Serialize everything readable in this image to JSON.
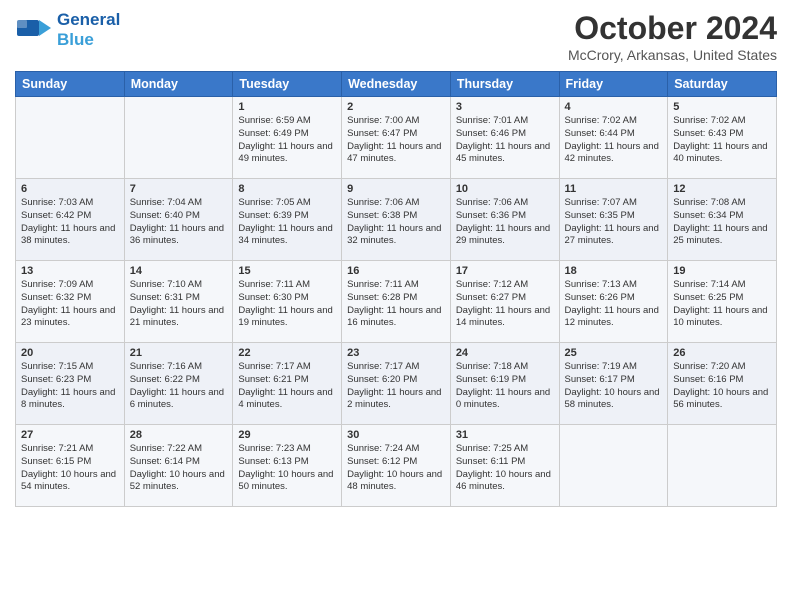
{
  "header": {
    "logo_line1": "General",
    "logo_line2": "Blue",
    "month_title": "October 2024",
    "subtitle": "McCrory, Arkansas, United States"
  },
  "days_of_week": [
    "Sunday",
    "Monday",
    "Tuesday",
    "Wednesday",
    "Thursday",
    "Friday",
    "Saturday"
  ],
  "weeks": [
    [
      {
        "day": "",
        "sunrise": "",
        "sunset": "",
        "daylight": ""
      },
      {
        "day": "",
        "sunrise": "",
        "sunset": "",
        "daylight": ""
      },
      {
        "day": "1",
        "sunrise": "Sunrise: 6:59 AM",
        "sunset": "Sunset: 6:49 PM",
        "daylight": "Daylight: 11 hours and 49 minutes."
      },
      {
        "day": "2",
        "sunrise": "Sunrise: 7:00 AM",
        "sunset": "Sunset: 6:47 PM",
        "daylight": "Daylight: 11 hours and 47 minutes."
      },
      {
        "day": "3",
        "sunrise": "Sunrise: 7:01 AM",
        "sunset": "Sunset: 6:46 PM",
        "daylight": "Daylight: 11 hours and 45 minutes."
      },
      {
        "day": "4",
        "sunrise": "Sunrise: 7:02 AM",
        "sunset": "Sunset: 6:44 PM",
        "daylight": "Daylight: 11 hours and 42 minutes."
      },
      {
        "day": "5",
        "sunrise": "Sunrise: 7:02 AM",
        "sunset": "Sunset: 6:43 PM",
        "daylight": "Daylight: 11 hours and 40 minutes."
      }
    ],
    [
      {
        "day": "6",
        "sunrise": "Sunrise: 7:03 AM",
        "sunset": "Sunset: 6:42 PM",
        "daylight": "Daylight: 11 hours and 38 minutes."
      },
      {
        "day": "7",
        "sunrise": "Sunrise: 7:04 AM",
        "sunset": "Sunset: 6:40 PM",
        "daylight": "Daylight: 11 hours and 36 minutes."
      },
      {
        "day": "8",
        "sunrise": "Sunrise: 7:05 AM",
        "sunset": "Sunset: 6:39 PM",
        "daylight": "Daylight: 11 hours and 34 minutes."
      },
      {
        "day": "9",
        "sunrise": "Sunrise: 7:06 AM",
        "sunset": "Sunset: 6:38 PM",
        "daylight": "Daylight: 11 hours and 32 minutes."
      },
      {
        "day": "10",
        "sunrise": "Sunrise: 7:06 AM",
        "sunset": "Sunset: 6:36 PM",
        "daylight": "Daylight: 11 hours and 29 minutes."
      },
      {
        "day": "11",
        "sunrise": "Sunrise: 7:07 AM",
        "sunset": "Sunset: 6:35 PM",
        "daylight": "Daylight: 11 hours and 27 minutes."
      },
      {
        "day": "12",
        "sunrise": "Sunrise: 7:08 AM",
        "sunset": "Sunset: 6:34 PM",
        "daylight": "Daylight: 11 hours and 25 minutes."
      }
    ],
    [
      {
        "day": "13",
        "sunrise": "Sunrise: 7:09 AM",
        "sunset": "Sunset: 6:32 PM",
        "daylight": "Daylight: 11 hours and 23 minutes."
      },
      {
        "day": "14",
        "sunrise": "Sunrise: 7:10 AM",
        "sunset": "Sunset: 6:31 PM",
        "daylight": "Daylight: 11 hours and 21 minutes."
      },
      {
        "day": "15",
        "sunrise": "Sunrise: 7:11 AM",
        "sunset": "Sunset: 6:30 PM",
        "daylight": "Daylight: 11 hours and 19 minutes."
      },
      {
        "day": "16",
        "sunrise": "Sunrise: 7:11 AM",
        "sunset": "Sunset: 6:28 PM",
        "daylight": "Daylight: 11 hours and 16 minutes."
      },
      {
        "day": "17",
        "sunrise": "Sunrise: 7:12 AM",
        "sunset": "Sunset: 6:27 PM",
        "daylight": "Daylight: 11 hours and 14 minutes."
      },
      {
        "day": "18",
        "sunrise": "Sunrise: 7:13 AM",
        "sunset": "Sunset: 6:26 PM",
        "daylight": "Daylight: 11 hours and 12 minutes."
      },
      {
        "day": "19",
        "sunrise": "Sunrise: 7:14 AM",
        "sunset": "Sunset: 6:25 PM",
        "daylight": "Daylight: 11 hours and 10 minutes."
      }
    ],
    [
      {
        "day": "20",
        "sunrise": "Sunrise: 7:15 AM",
        "sunset": "Sunset: 6:23 PM",
        "daylight": "Daylight: 11 hours and 8 minutes."
      },
      {
        "day": "21",
        "sunrise": "Sunrise: 7:16 AM",
        "sunset": "Sunset: 6:22 PM",
        "daylight": "Daylight: 11 hours and 6 minutes."
      },
      {
        "day": "22",
        "sunrise": "Sunrise: 7:17 AM",
        "sunset": "Sunset: 6:21 PM",
        "daylight": "Daylight: 11 hours and 4 minutes."
      },
      {
        "day": "23",
        "sunrise": "Sunrise: 7:17 AM",
        "sunset": "Sunset: 6:20 PM",
        "daylight": "Daylight: 11 hours and 2 minutes."
      },
      {
        "day": "24",
        "sunrise": "Sunrise: 7:18 AM",
        "sunset": "Sunset: 6:19 PM",
        "daylight": "Daylight: 11 hours and 0 minutes."
      },
      {
        "day": "25",
        "sunrise": "Sunrise: 7:19 AM",
        "sunset": "Sunset: 6:17 PM",
        "daylight": "Daylight: 10 hours and 58 minutes."
      },
      {
        "day": "26",
        "sunrise": "Sunrise: 7:20 AM",
        "sunset": "Sunset: 6:16 PM",
        "daylight": "Daylight: 10 hours and 56 minutes."
      }
    ],
    [
      {
        "day": "27",
        "sunrise": "Sunrise: 7:21 AM",
        "sunset": "Sunset: 6:15 PM",
        "daylight": "Daylight: 10 hours and 54 minutes."
      },
      {
        "day": "28",
        "sunrise": "Sunrise: 7:22 AM",
        "sunset": "Sunset: 6:14 PM",
        "daylight": "Daylight: 10 hours and 52 minutes."
      },
      {
        "day": "29",
        "sunrise": "Sunrise: 7:23 AM",
        "sunset": "Sunset: 6:13 PM",
        "daylight": "Daylight: 10 hours and 50 minutes."
      },
      {
        "day": "30",
        "sunrise": "Sunrise: 7:24 AM",
        "sunset": "Sunset: 6:12 PM",
        "daylight": "Daylight: 10 hours and 48 minutes."
      },
      {
        "day": "31",
        "sunrise": "Sunrise: 7:25 AM",
        "sunset": "Sunset: 6:11 PM",
        "daylight": "Daylight: 10 hours and 46 minutes."
      },
      {
        "day": "",
        "sunrise": "",
        "sunset": "",
        "daylight": ""
      },
      {
        "day": "",
        "sunrise": "",
        "sunset": "",
        "daylight": ""
      }
    ]
  ]
}
